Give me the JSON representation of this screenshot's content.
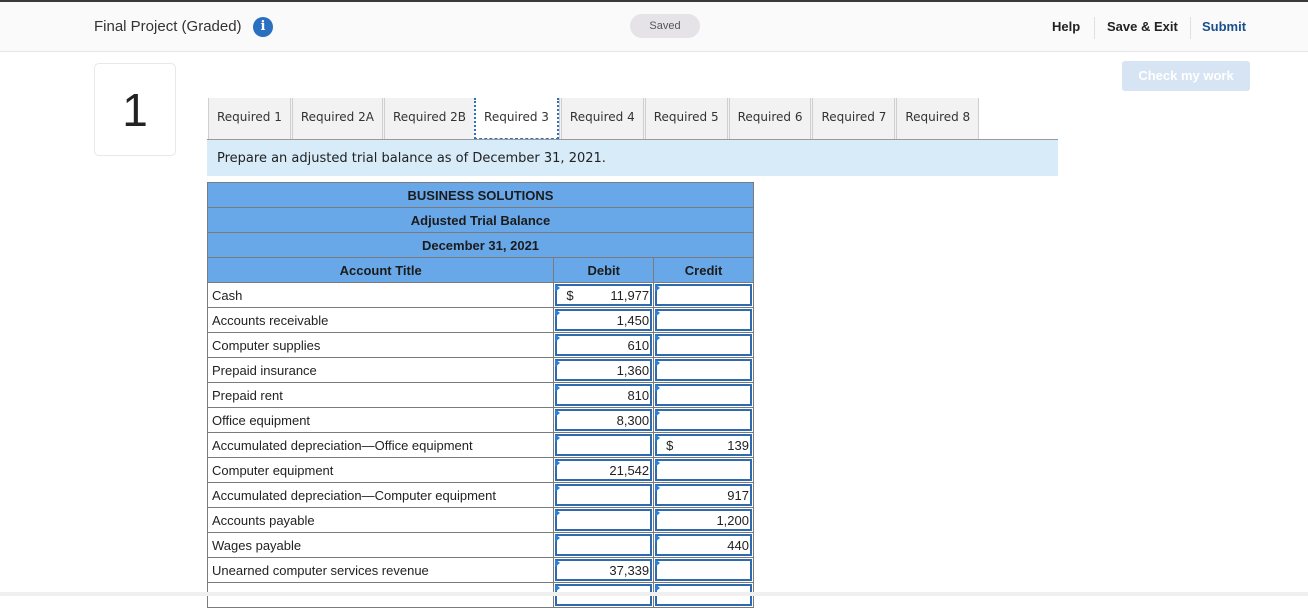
{
  "header": {
    "title": "Final Project (Graded)",
    "info_icon": "info-icon",
    "saved_status": "Saved",
    "help_label": "Help",
    "save_exit_label": "Save & Exit",
    "submit_label": "Submit",
    "check_work_label": "Check my work"
  },
  "question_number": "1",
  "tabs": [
    {
      "label": "Required 1",
      "active": false
    },
    {
      "label": "Required 2A",
      "active": false
    },
    {
      "label": "Required 2B",
      "active": false
    },
    {
      "label": "Required 3",
      "active": true
    },
    {
      "label": "Required 4",
      "active": false
    },
    {
      "label": "Required 5",
      "active": false
    },
    {
      "label": "Required 6",
      "active": false
    },
    {
      "label": "Required 7",
      "active": false
    },
    {
      "label": "Required 8",
      "active": false
    }
  ],
  "instructions": "Prepare an adjusted trial balance as of December 31, 2021.",
  "trial_balance": {
    "company": "BUSINESS SOLUTIONS",
    "statement": "Adjusted Trial Balance",
    "date": "December 31, 2021",
    "columns": {
      "account": "Account Title",
      "debit": "Debit",
      "credit": "Credit"
    },
    "rows": [
      {
        "account": "Cash",
        "debit_currency": "$",
        "debit": "11,977",
        "credit_currency": "",
        "credit": ""
      },
      {
        "account": "Accounts receivable",
        "debit_currency": "",
        "debit": "1,450",
        "credit_currency": "",
        "credit": ""
      },
      {
        "account": "Computer supplies",
        "debit_currency": "",
        "debit": "610",
        "credit_currency": "",
        "credit": ""
      },
      {
        "account": "Prepaid insurance",
        "debit_currency": "",
        "debit": "1,360",
        "credit_currency": "",
        "credit": ""
      },
      {
        "account": "Prepaid rent",
        "debit_currency": "",
        "debit": "810",
        "credit_currency": "",
        "credit": ""
      },
      {
        "account": "Office equipment",
        "debit_currency": "",
        "debit": "8,300",
        "credit_currency": "",
        "credit": ""
      },
      {
        "account": "Accumulated depreciation—Office equipment",
        "debit_currency": "",
        "debit": "",
        "credit_currency": "$",
        "credit": "139"
      },
      {
        "account": "Computer equipment",
        "debit_currency": "",
        "debit": "21,542",
        "credit_currency": "",
        "credit": ""
      },
      {
        "account": "Accumulated depreciation—Computer equipment",
        "debit_currency": "",
        "debit": "",
        "credit_currency": "",
        "credit": "917"
      },
      {
        "account": "Accounts payable",
        "debit_currency": "",
        "debit": "",
        "credit_currency": "",
        "credit": "1,200"
      },
      {
        "account": "Wages payable",
        "debit_currency": "",
        "debit": "",
        "credit_currency": "",
        "credit": "440"
      },
      {
        "account": "Unearned computer services revenue",
        "debit_currency": "",
        "debit": "37,339",
        "credit_currency": "",
        "credit": ""
      },
      {
        "account": "",
        "debit_currency": "",
        "debit": "",
        "credit_currency": "",
        "credit": ""
      }
    ]
  }
}
